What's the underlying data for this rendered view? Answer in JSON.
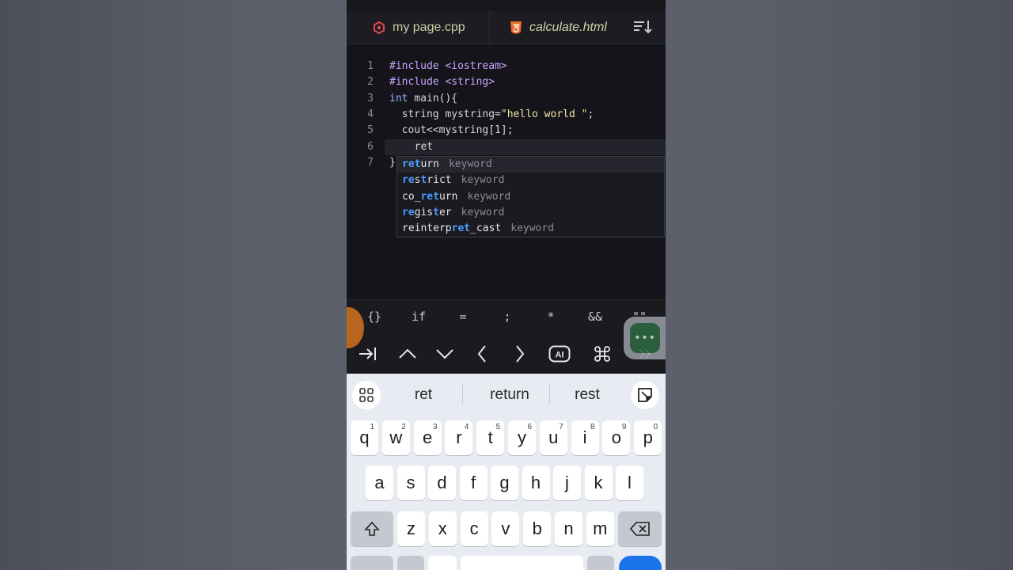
{
  "tabs": [
    {
      "label": "my page.cpp",
      "icon": "cpp-file-icon"
    },
    {
      "label": "calculate.html",
      "icon": "html5-file-icon"
    }
  ],
  "editor": {
    "lines": [
      {
        "num": "1",
        "segments": [
          {
            "t": "#include ",
            "c": "pp"
          },
          {
            "t": "<iostream>",
            "c": "pp"
          }
        ]
      },
      {
        "num": "2",
        "segments": [
          {
            "t": "#include ",
            "c": "pp"
          },
          {
            "t": "<string>",
            "c": "pp"
          }
        ]
      },
      {
        "num": "3",
        "segments": [
          {
            "t": "int",
            "c": "kw"
          },
          {
            "t": " main(){",
            "c": ""
          }
        ]
      },
      {
        "num": "4",
        "segments": [
          {
            "t": "  string mystring=",
            "c": ""
          },
          {
            "t": "\"hello world \"",
            "c": "str"
          },
          {
            "t": ";",
            "c": ""
          }
        ]
      },
      {
        "num": "5",
        "segments": [
          {
            "t": "  cout<<mystring[1];",
            "c": ""
          }
        ]
      },
      {
        "num": "6",
        "segments": [
          {
            "t": "  ret",
            "c": ""
          }
        ]
      },
      {
        "num": "7",
        "segments": [
          {
            "t": "}",
            "c": ""
          }
        ]
      }
    ],
    "active_line": 6
  },
  "autocomplete": {
    "items": [
      {
        "parts": [
          {
            "t": "ret",
            "hl": true
          },
          {
            "t": "urn",
            "hl": false
          }
        ],
        "kind": "keyword"
      },
      {
        "parts": [
          {
            "t": "re",
            "hl": true
          },
          {
            "t": "s",
            "hl": false
          },
          {
            "t": "t",
            "hl": true
          },
          {
            "t": "rict",
            "hl": false
          }
        ],
        "kind": "keyword"
      },
      {
        "parts": [
          {
            "t": "co_",
            "hl": false
          },
          {
            "t": "ret",
            "hl": true
          },
          {
            "t": "urn",
            "hl": false
          }
        ],
        "kind": "keyword"
      },
      {
        "parts": [
          {
            "t": "re",
            "hl": true
          },
          {
            "t": "gis",
            "hl": false
          },
          {
            "t": "t",
            "hl": true
          },
          {
            "t": "er",
            "hl": false
          }
        ],
        "kind": "keyword"
      },
      {
        "parts": [
          {
            "t": "reinterp",
            "hl": false
          },
          {
            "t": "ret",
            "hl": true
          },
          {
            "t": "_cast",
            "hl": false
          }
        ],
        "kind": "keyword"
      }
    ]
  },
  "symbols": [
    "{}",
    "if",
    "=",
    ";",
    "*",
    "&&",
    "\"\""
  ],
  "nav_icons": [
    "tab-indent-icon",
    "chevron-up-icon",
    "chevron-down-icon",
    "chevron-left-icon",
    "chevron-right-icon",
    "ai-icon",
    "command-icon",
    "double-chevron-right-icon"
  ],
  "keyboard": {
    "suggestions": [
      "ret",
      "return",
      "rest"
    ],
    "row1": [
      {
        "k": "q",
        "s": "1"
      },
      {
        "k": "w",
        "s": "2"
      },
      {
        "k": "e",
        "s": "3"
      },
      {
        "k": "r",
        "s": "4"
      },
      {
        "k": "t",
        "s": "5"
      },
      {
        "k": "y",
        "s": "6"
      },
      {
        "k": "u",
        "s": "7"
      },
      {
        "k": "i",
        "s": "8"
      },
      {
        "k": "o",
        "s": "9"
      },
      {
        "k": "p",
        "s": "0"
      }
    ],
    "row2": [
      "a",
      "s",
      "d",
      "f",
      "g",
      "h",
      "j",
      "k",
      "l"
    ],
    "row3": [
      "z",
      "x",
      "c",
      "v",
      "b",
      "n",
      "m"
    ]
  },
  "colors": {
    "accent_blue": "#4a9cff",
    "chat_green": "#2e6b45",
    "bubble_orange": "#b7651f"
  }
}
